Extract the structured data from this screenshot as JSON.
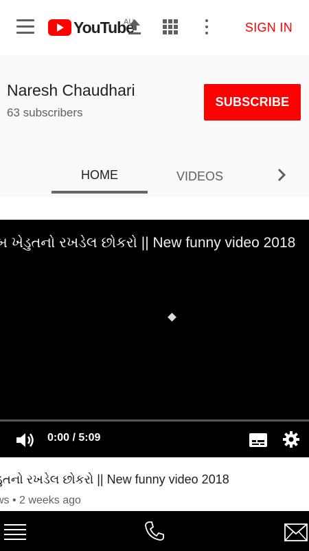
{
  "header": {
    "logo_text": "YouTube",
    "country_code": "AU",
    "sign_in_label": "SIGN IN"
  },
  "channel": {
    "name": "Naresh Chaudhari",
    "subscribers": "63 subscribers",
    "subscribe_label": "SUBSCRIBE"
  },
  "tabs": [
    {
      "label": "HOME",
      "active": true
    },
    {
      "label": "VIDEOS",
      "active": false
    }
  ],
  "player": {
    "title_overlay": "બ ખેડુતનો રખડેલ છોકરો || New funny video 2018",
    "time_display": "0:00 / 5:09",
    "progress_fraction": 0
  },
  "video": {
    "title": "ડુતનો રખડેલ છોકરો || New funny video 2018",
    "meta": "ws • 2 weeks ago"
  },
  "icons": {
    "menu": "hamburger-icon",
    "upload": "upload-icon",
    "apps": "apps-grid-icon",
    "more": "more-vert-icon",
    "next": "chevron-right-icon",
    "volume": "volume-icon",
    "captions": "captions-icon",
    "settings": "gear-icon",
    "phone": "phone-icon",
    "mail": "mail-icon"
  },
  "colors": {
    "brand_red": "#ff0000",
    "header_bg": "#ffffff",
    "channel_bg": "#f9f9f9",
    "player_bg": "#000000"
  }
}
